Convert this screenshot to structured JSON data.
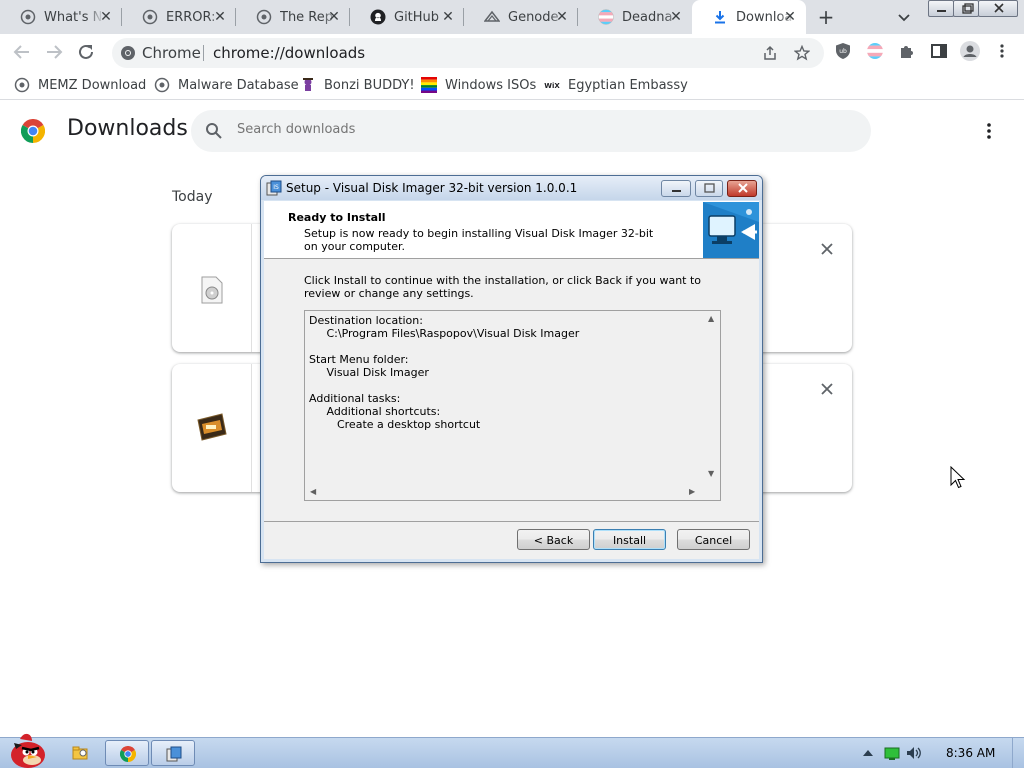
{
  "tabs": [
    {
      "label": "What's N",
      "icon": "globe-icon"
    },
    {
      "label": "ERROR:",
      "icon": "globe-icon"
    },
    {
      "label": "The Rep",
      "icon": "globe-icon"
    },
    {
      "label": "GitHub",
      "icon": "github-icon"
    },
    {
      "label": "Genode",
      "icon": "genode-icon"
    },
    {
      "label": "Deadna",
      "icon": "trans-flag-icon"
    },
    {
      "label": "Downloa",
      "icon": "download-icon"
    }
  ],
  "omnibox": {
    "scheme": "Chrome",
    "url": "chrome://downloads"
  },
  "bookmarks": [
    {
      "label": "MEMZ Download",
      "icon": "globe-icon"
    },
    {
      "label": "Malware Database",
      "icon": "globe-icon"
    },
    {
      "label": "Bonzi BUDDY!",
      "icon": "bonzi-icon"
    },
    {
      "label": "Windows ISOs",
      "icon": "rainbow-flag-icon"
    },
    {
      "label": "Egyptian Embassy",
      "icon": "wix-icon"
    }
  ],
  "downloads": {
    "title": "Downloads",
    "search_placeholder": "Search downloads",
    "section": "Today"
  },
  "setup": {
    "title": "Setup - Visual Disk Imager 32-bit version 1.0.0.1",
    "heading": "Ready to Install",
    "subheading": "Setup is now ready to begin installing Visual Disk Imager 32-bit on your computer.",
    "intro": "Click Install to continue with the installation, or click Back if you want to review or change any settings.",
    "memo": [
      "Destination location:",
      "     C:\\Program Files\\Raspopov\\Visual Disk Imager",
      "",
      "Start Menu folder:",
      "     Visual Disk Imager",
      "",
      "Additional tasks:",
      "     Additional shortcuts:",
      "        Create a desktop shortcut"
    ],
    "back_label": "< Back",
    "install_label": "Install",
    "cancel_label": "Cancel"
  },
  "taskbar": {
    "clock": "8:36 AM"
  },
  "colors": {
    "chrome_tabstrip": "#dee1e6",
    "dialog_frame": "#d7e4f2",
    "taskbar": "#b9cde8",
    "close_red": "#c0392b"
  }
}
